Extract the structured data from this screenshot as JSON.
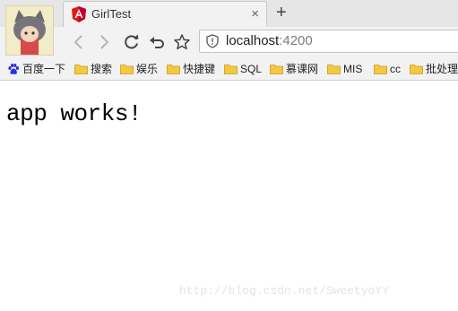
{
  "tab": {
    "title": "GirlTest",
    "close_label": "×"
  },
  "new_tab_label": "+",
  "address_bar": {
    "host": "localhost",
    "port": ":4200"
  },
  "bookmarks": [
    {
      "label": "百度一下",
      "icon": "baidu-paw-icon"
    },
    {
      "label": "搜索",
      "icon": "folder-icon"
    },
    {
      "label": "娱乐",
      "icon": "folder-icon"
    },
    {
      "label": "快捷键",
      "icon": "folder-icon"
    },
    {
      "label": "SQL",
      "icon": "folder-icon"
    },
    {
      "label": "慕课网",
      "icon": "folder-icon"
    },
    {
      "label": "MIS",
      "icon": "folder-icon"
    },
    {
      "label": "cc",
      "icon": "folder-icon"
    },
    {
      "label": "批处理",
      "icon": "folder-icon"
    }
  ],
  "page": {
    "heading": "app works!"
  },
  "watermark": "http://blog.csdn.net/SweetyoYY",
  "colors": {
    "angular_red": "#dd1b16",
    "folder_yellow": "#f5c842",
    "baidu_blue": "#2932e1"
  }
}
